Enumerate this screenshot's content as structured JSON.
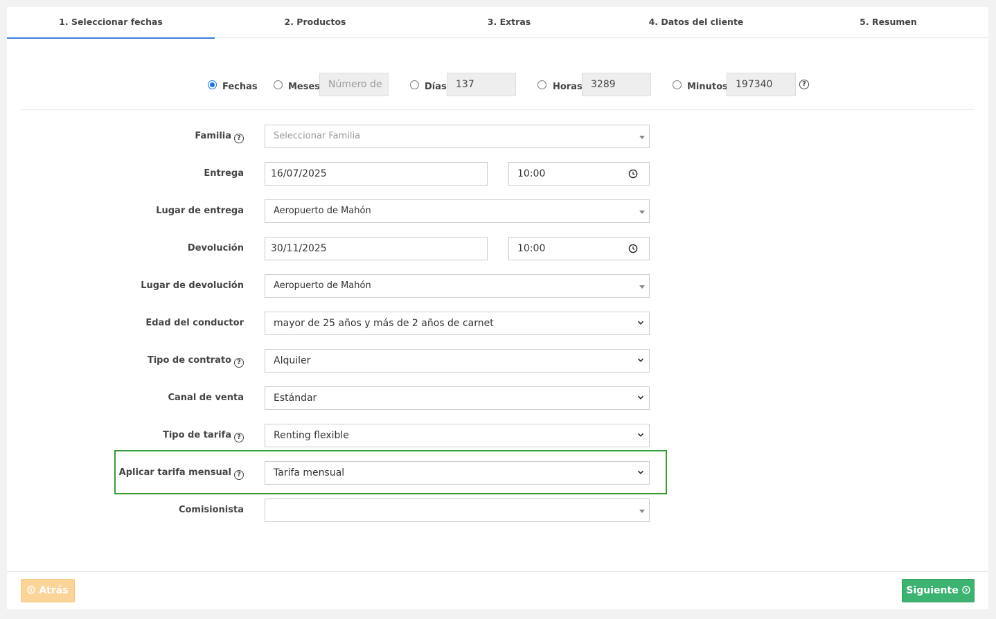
{
  "tabs": [
    {
      "label": "1. Seleccionar fechas"
    },
    {
      "label": "2. Productos"
    },
    {
      "label": "3. Extras"
    },
    {
      "label": "4. Datos del cliente"
    },
    {
      "label": "5. Resumen"
    }
  ],
  "modes": {
    "fechas": {
      "label": "Fechas"
    },
    "meses": {
      "label": "Meses",
      "placeholder": "Número de"
    },
    "dias": {
      "label": "Días",
      "value": "137"
    },
    "horas": {
      "label": "Horas",
      "value": "3289"
    },
    "minutos": {
      "label": "Minutos",
      "value": "197340"
    }
  },
  "help_glyph": "?",
  "form": {
    "familia": {
      "label": "Familia",
      "placeholder": "Seleccionar Familia"
    },
    "entrega": {
      "label": "Entrega",
      "date": "16/07/2025",
      "time": "10:00"
    },
    "lugar_entrega": {
      "label": "Lugar de entrega",
      "value": "Aeropuerto de Mahón"
    },
    "devolucion": {
      "label": "Devolución",
      "date": "30/11/2025",
      "time": "10:00"
    },
    "lugar_devolucion": {
      "label": "Lugar de devolución",
      "value": "Aeropuerto de Mahón"
    },
    "edad": {
      "label": "Edad del conductor",
      "value": "mayor de 25 años y más de 2 años de carnet"
    },
    "tipo_contrato": {
      "label": "Tipo de contrato",
      "value": "Alquiler"
    },
    "canal": {
      "label": "Canal de venta",
      "value": "Estándar"
    },
    "tipo_tarifa": {
      "label": "Tipo de tarifa",
      "value": "Renting flexible"
    },
    "tarifa_mensual": {
      "label": "Aplicar tarifa mensual",
      "value": "Tarifa mensual"
    },
    "comisionista": {
      "label": "Comisionista",
      "value": ""
    }
  },
  "buttons": {
    "back": "Atrás",
    "next": "Siguiente"
  },
  "colors": {
    "accent": "#3b7ddd",
    "highlight": "#3a9a34",
    "next": "#3cb371",
    "back": "#fbd49a"
  }
}
